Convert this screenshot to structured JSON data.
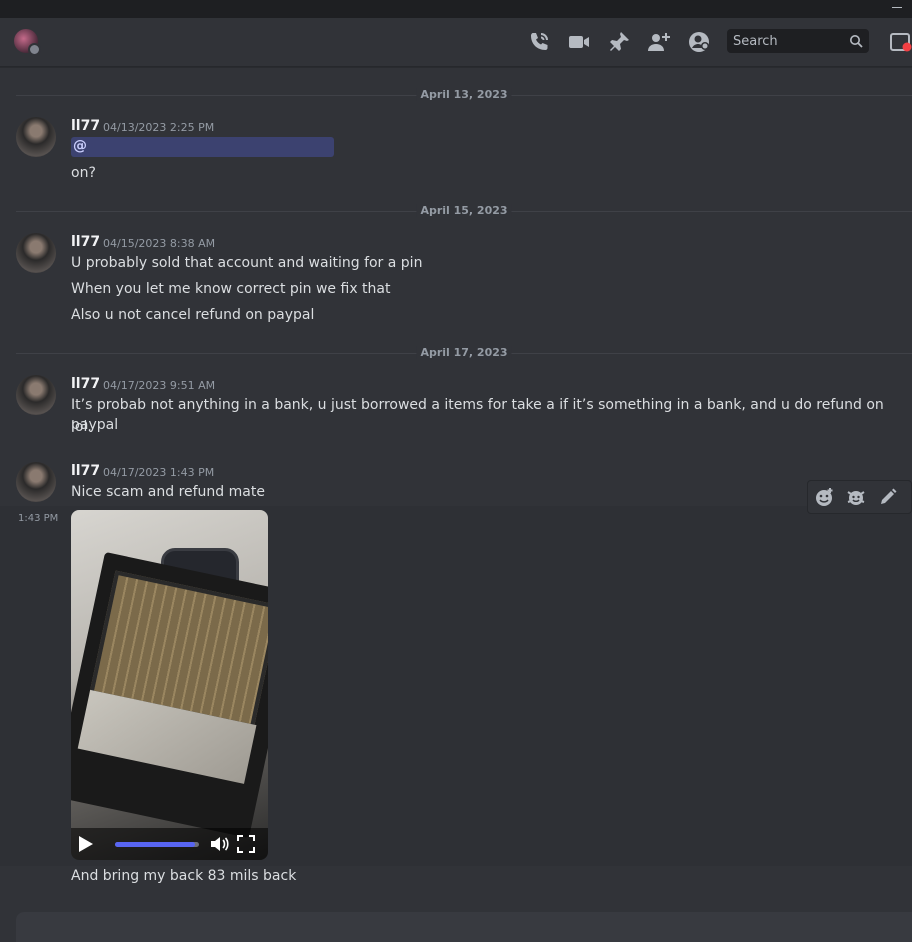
{
  "header": {
    "search_placeholder": "Search",
    "icons": [
      "start-voice-call-icon",
      "start-video-call-icon",
      "pinned-messages-icon",
      "add-friends-icon",
      "user-profile-icon",
      "search-icon",
      "inbox-icon"
    ]
  },
  "messages": {
    "dividers": [
      "April 13, 2023",
      "April 15, 2023",
      "April 17, 2023"
    ],
    "groups": [
      {
        "author": "ll77",
        "timestamp": "04/13/2023 2:25 PM",
        "mention": "@",
        "lines": [
          "on?"
        ]
      },
      {
        "author": "ll77",
        "timestamp": "04/15/2023 8:38 AM",
        "lines": [
          "U probably sold that account and waiting for a pin",
          "When you let me know correct pin we fix that",
          "Also u not cancel refund on paypal"
        ]
      },
      {
        "author": "ll77",
        "timestamp": "04/17/2023 9:51 AM",
        "lines": [
          "It’s probab not anything in a bank, u just borrowed a items for take a if it’s something in a bank, and u do refund on paypal",
          "lol."
        ]
      },
      {
        "author": "ll77",
        "timestamp": "04/17/2023 1:43 PM",
        "hover_time": "1:43 PM",
        "lines": [
          "Nice scam and refund mate",
          "And bring my back 83 mils back"
        ],
        "video_progress": 0.95
      }
    ]
  },
  "colors": {
    "accent": "#5865f2",
    "background": "#313338",
    "mention_bg": "#3c4270",
    "notification": "#f23f43"
  }
}
